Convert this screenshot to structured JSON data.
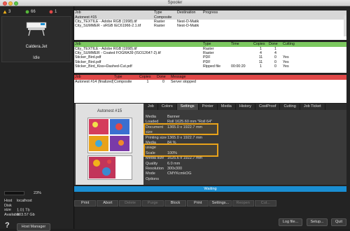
{
  "window": {
    "title": "Spooler"
  },
  "sidebar": {
    "warnings": "3",
    "jobs": "66",
    "errors": "1",
    "printer_name": "Caldera.Jet",
    "printer_state": "Idle",
    "progress_percent": "23%",
    "host_rows": [
      {
        "label": "Host",
        "value": "localhost"
      },
      {
        "label": "Disk size",
        "value": "1.01 Tb"
      },
      {
        "label": "Available",
        "value": "803.57 Gb"
      }
    ],
    "host_manager": "Host Manager"
  },
  "queue_table": {
    "headers": [
      "Job",
      "Type",
      "Destination",
      "Progress"
    ],
    "rows": [
      [
        "Autonest #15",
        "Composite",
        "",
        ""
      ],
      [
        "City_TEXTILE - Adobe RGB (1998).tif",
        "Raster",
        "Nest-O-Matik",
        ""
      ],
      [
        "City_SUMMER - sRGB IEC61966-2.1.tif",
        "Raster",
        "Nest-O-Matik",
        ""
      ]
    ]
  },
  "jobs_table": {
    "headers": [
      "Job",
      "Type",
      "Time",
      "Copies",
      "Done",
      "Cutting"
    ],
    "rows": [
      [
        "City_TEXTILE - Adobe RGB (1998).tif",
        "Raster",
        "",
        "1",
        "1",
        ""
      ],
      [
        "City_SUMMER - Coated FOGRA39 (ISO12647-2).tif",
        "Raster",
        "",
        "4",
        "4",
        ""
      ],
      [
        "Sticker_Bird.pdf",
        "PDF",
        "",
        "11",
        "0",
        "Yes"
      ],
      [
        "Sticker_Bird.pdf",
        "PDF",
        "",
        "11",
        "0",
        "Yes"
      ],
      [
        "Sticker_Bird_Kiss+Dashed-Cut.pdf",
        "Ripped file",
        "00:00:20",
        "1",
        "0",
        "Yes"
      ]
    ]
  },
  "error_table": {
    "headers": [
      "Job",
      "Type",
      "Copies",
      "Done",
      "Message"
    ],
    "rows": [
      [
        "Autonest #14 (finalized)",
        "Composite",
        "1",
        "0",
        "Server stopped"
      ]
    ]
  },
  "detail": {
    "preview_title": "Autonest #15",
    "tabs": [
      "Job",
      "Colors",
      "Settings",
      "Printer",
      "Media",
      "History",
      "CostProof",
      "Cutting",
      "Job Ticket"
    ],
    "active_tab": "Settings",
    "props": [
      {
        "k": "Media",
        "v": "Banner"
      },
      {
        "k": "Loaded",
        "v": "Roll 1625.60 mm \"Roll 64\""
      },
      {
        "k": "Document size",
        "v": "1365.0 x 1922.7 mm"
      },
      {
        "k": "Printing size",
        "v": "1365.0 x 1922.7 mm"
      },
      {
        "k": "Media usage",
        "v": "84 %"
      },
      {
        "k": "Scale",
        "v": "100%"
      },
      {
        "k": "Media size",
        "v": "1625.6 x 1922.7 mm"
      },
      {
        "k": "Quality",
        "v": "6.0 mm"
      },
      {
        "k": "Resolution",
        "v": "300x300"
      },
      {
        "k": "Mode",
        "v": "CMYKcmkOG"
      },
      {
        "k": "Options",
        "v": ""
      }
    ],
    "status": "Waiting"
  },
  "actions": [
    "Print",
    "Abort",
    "Delete",
    "Purge",
    "Block",
    "Print",
    "Settings...",
    "Reopen",
    "Cut..."
  ],
  "bottom": {
    "log": "Log file...",
    "setup": "Setup...",
    "quit": "Quit"
  },
  "colors": {
    "accent": "#1a8ed2",
    "highlight": "#e8a21a",
    "queue_head": "#d8d8d8",
    "jobs_head": "#7cc860",
    "error_head": "#e04848"
  }
}
